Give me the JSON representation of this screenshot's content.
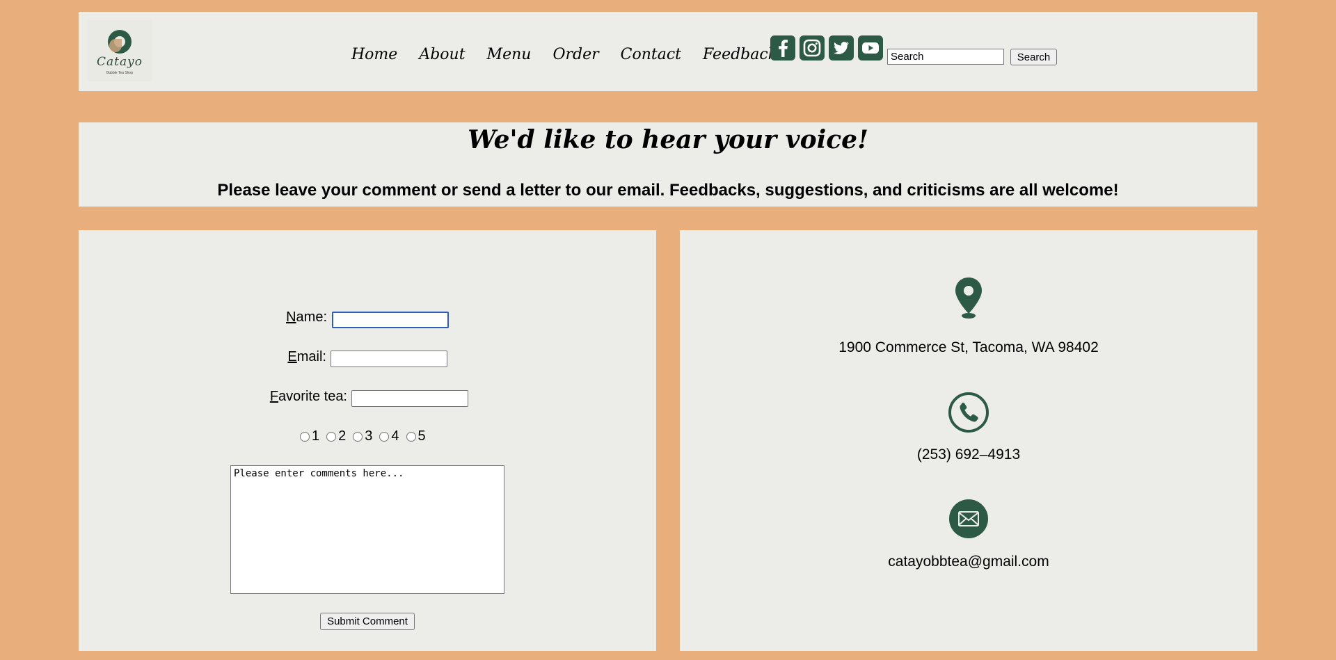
{
  "logo": {
    "name": "Catayo",
    "subtitle": "Bubble Tea Shop"
  },
  "nav": {
    "items": [
      "Home",
      "About",
      "Menu",
      "Order",
      "Contact",
      "Feedbacks"
    ]
  },
  "social": [
    "facebook-icon",
    "instagram-icon",
    "twitter-icon",
    "youtube-icon"
  ],
  "search": {
    "value": "Search",
    "button": "Search"
  },
  "intro": {
    "title": "We'd like to hear your voice!",
    "text": "Please leave your comment or send a letter to our email. Feedbacks, suggestions, and criticisms are all welcome!"
  },
  "form": {
    "name_key": "N",
    "name_rest": "ame:",
    "email_key": "E",
    "email_rest": "mail:",
    "tea_key": "F",
    "tea_rest": "avorite tea:",
    "ratings": [
      "1",
      "2",
      "3",
      "4",
      "5"
    ],
    "comments_placeholder": "Please enter comments here...",
    "submit": "Submit Comment"
  },
  "contact": {
    "address": "1900 Commerce St, Tacoma, WA 98402",
    "phone": "(253) 692–4913",
    "email": "catayobbtea@gmail.com"
  },
  "colors": {
    "background": "#e8ae7b",
    "panel": "#ecede8",
    "accent": "#2d5a44"
  }
}
